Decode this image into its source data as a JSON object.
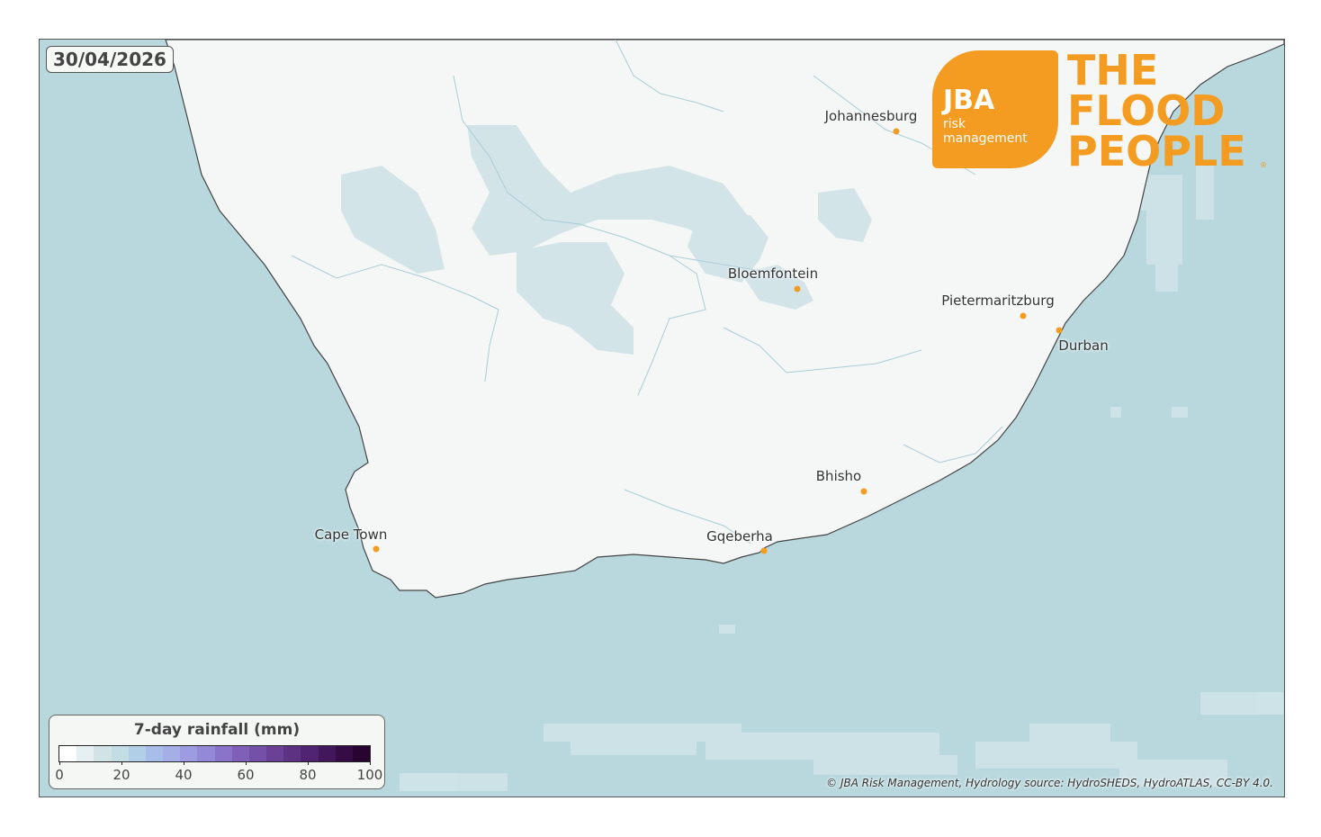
{
  "date": "30/04/2026",
  "colors": {
    "ocean": "#b8d8de",
    "land": "#f4f7f5",
    "rain_light": "#d3e4e8",
    "city_dot": "#f39c21",
    "brand": "#f39c21"
  },
  "cities": [
    {
      "name": "Johannesburg"
    },
    {
      "name": "Bloemfontein"
    },
    {
      "name": "Pietermaritzburg"
    },
    {
      "name": "Durban"
    },
    {
      "name": "Bhisho"
    },
    {
      "name": "Cape Town"
    },
    {
      "name": "Gqeberha"
    }
  ],
  "logo": {
    "jba": "JBA",
    "sub": "risk management",
    "line1": "THE",
    "line2": "FLOOD",
    "line3": "PEOPLE",
    "reg": "®"
  },
  "legend": {
    "title": "7-day rainfall (mm)",
    "ticks": [
      "0",
      "20",
      "40",
      "60",
      "80",
      "100"
    ],
    "colors": [
      "#ffffff",
      "#e6eff1",
      "#d2e3e6",
      "#c2dde3",
      "#b2cfe8",
      "#a9bdea",
      "#a6aee8",
      "#9d9ce0",
      "#9389d6",
      "#8a74c9",
      "#7f5fb8",
      "#7550a8",
      "#6a4196",
      "#5e3283",
      "#512471",
      "#43175c",
      "#350c46",
      "#280530"
    ]
  },
  "credit": "© JBA Risk Management, Hydrology source: HydroSHEDS, HydroATLAS, CC-BY 4.0."
}
